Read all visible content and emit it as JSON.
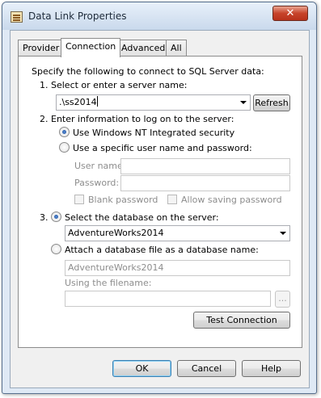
{
  "window": {
    "title": "Data Link Properties",
    "close_symbol": "✕"
  },
  "tabs": [
    {
      "label": "Provider",
      "active": false
    },
    {
      "label": "Connection",
      "active": true
    },
    {
      "label": "Advanced",
      "active": false
    },
    {
      "label": "All",
      "active": false
    }
  ],
  "connection": {
    "intro": "Specify the following to connect to SQL Server data:",
    "step1_label": "1. Select or enter a server name:",
    "server_value": ".\\ss2014",
    "refresh_label": "Refresh",
    "step2_label": "2. Enter information to log on to the server:",
    "radio_nt_security": "Use Windows NT Integrated security",
    "radio_specific_user": "Use a specific user name and password:",
    "username_label": "User name:",
    "username_value": "",
    "password_label": "Password:",
    "password_value": "",
    "blank_password_label": "Blank password",
    "allow_saving_label": "Allow saving password",
    "step3_number": "3.",
    "radio_select_db": "Select the database on the server:",
    "database_value": "AdventureWorks2014",
    "radio_attach_db": "Attach a database file as a database name:",
    "attach_name_value": "AdventureWorks2014",
    "filename_label": "Using the filename:",
    "filename_value": "",
    "browse_label": "...",
    "test_connection_label": "Test Connection"
  },
  "footer": {
    "ok_label": "OK",
    "cancel_label": "Cancel",
    "help_label": "Help"
  },
  "colors": {
    "window_frame": "#dfe9f5",
    "close_button": "#c7432a",
    "radio_dot": "#1d4e9b"
  }
}
